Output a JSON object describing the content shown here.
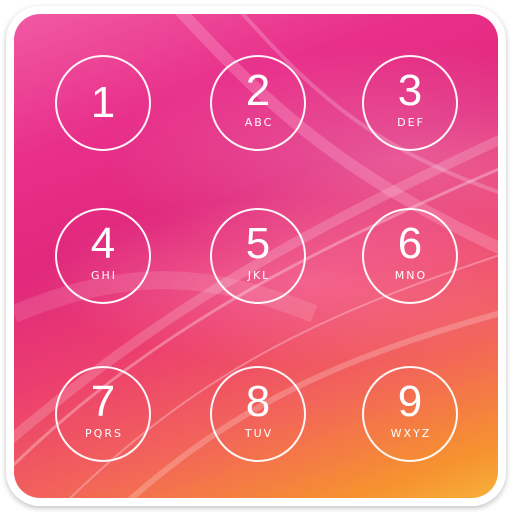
{
  "keypad": {
    "keys": [
      {
        "digit": "1",
        "letters": ""
      },
      {
        "digit": "2",
        "letters": "ABC"
      },
      {
        "digit": "3",
        "letters": "DEF"
      },
      {
        "digit": "4",
        "letters": "GHI"
      },
      {
        "digit": "5",
        "letters": "JKL"
      },
      {
        "digit": "6",
        "letters": "MNO"
      },
      {
        "digit": "7",
        "letters": "PQRS"
      },
      {
        "digit": "8",
        "letters": "TUV"
      },
      {
        "digit": "9",
        "letters": "WXYZ"
      }
    ]
  },
  "colors": {
    "ring": "#ffffff",
    "wallpaper_top": "#e8308a",
    "wallpaper_bottom": "#f6922f"
  }
}
